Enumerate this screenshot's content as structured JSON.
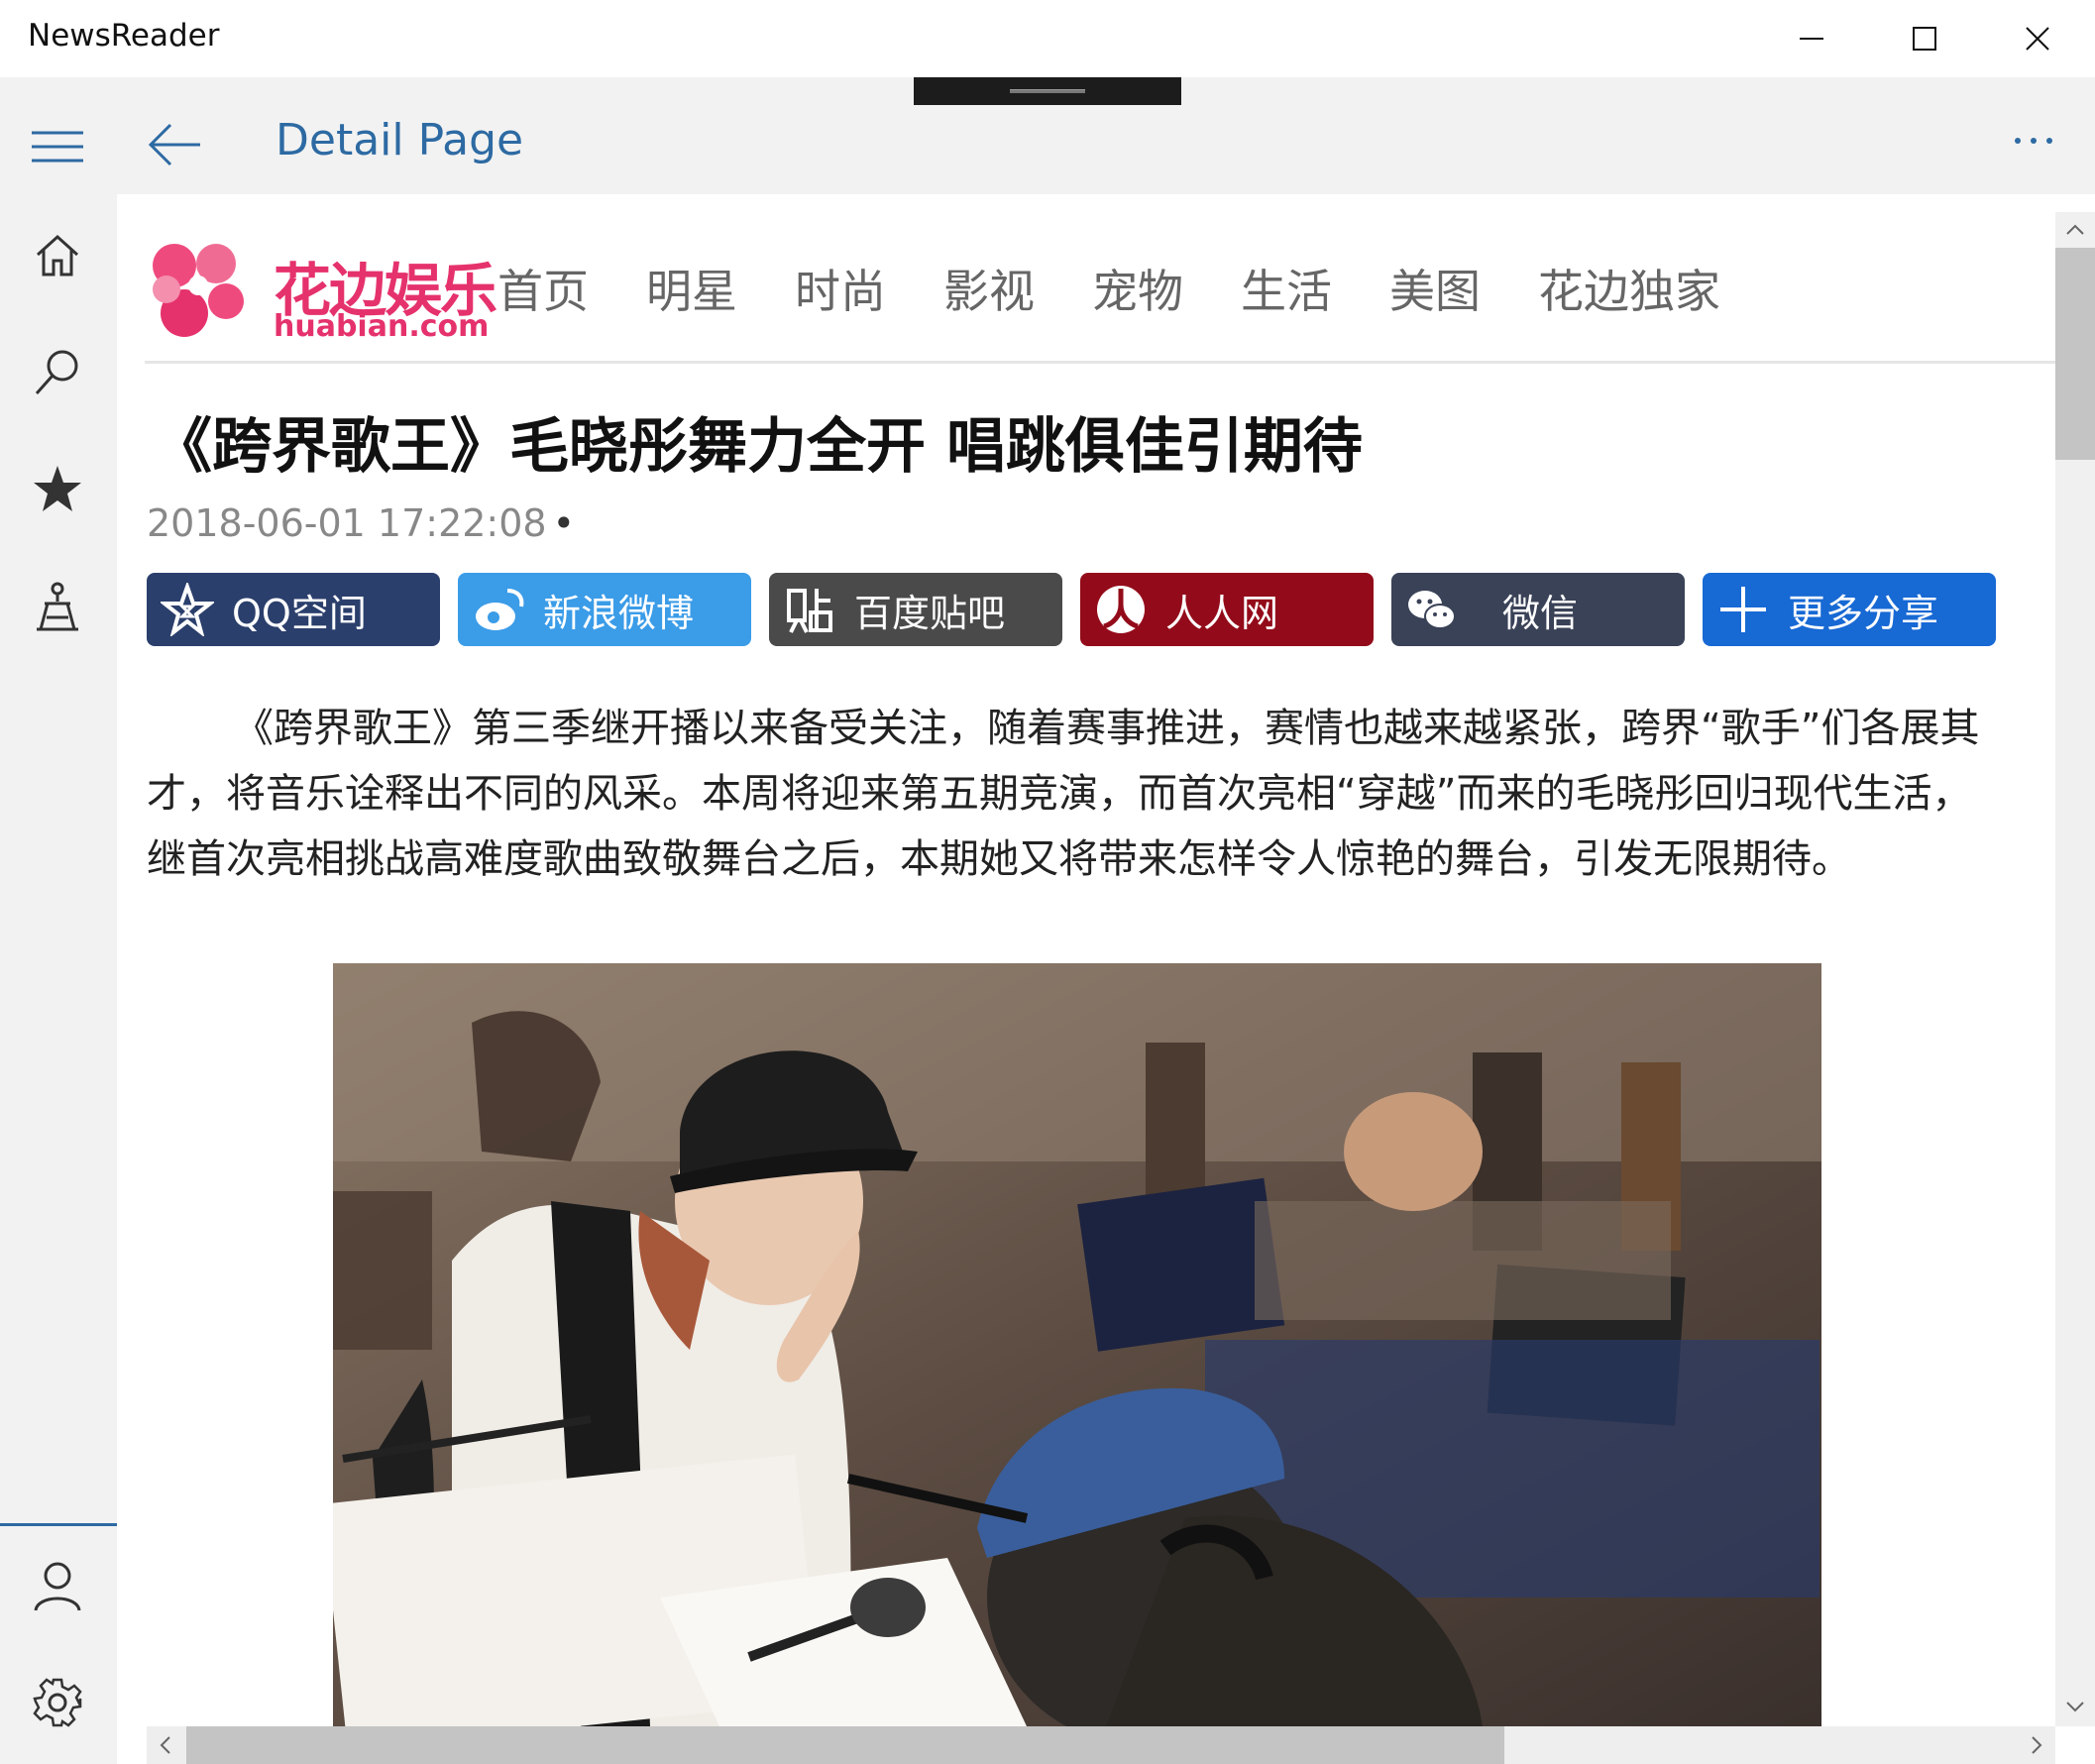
{
  "window": {
    "app_title": "NewsReader",
    "controls": [
      "minimize-icon",
      "maximize-icon",
      "close-icon"
    ]
  },
  "header": {
    "title": "Detail Page",
    "left_icons": [
      "hamburger-menu-icon",
      "back-arrow-icon"
    ],
    "right_icon": "more-ellipsis-icon"
  },
  "rail": {
    "top_items": [
      "home-icon",
      "search-icon",
      "favorites-star-icon",
      "explore-icon"
    ],
    "bottom_items": [
      "account-icon",
      "settings-gear-icon"
    ]
  },
  "site": {
    "logo_cn": "花边娱乐",
    "logo_en": "huabian.com",
    "nav": [
      "首页",
      "明星",
      "时尚",
      "影视",
      "宠物",
      "生活",
      "美图",
      "花边独家"
    ]
  },
  "article": {
    "title": "《跨界歌王》毛晓彤舞力全开 唱跳俱佳引期待",
    "time": "2018-06-01 17:22:08",
    "time_suffix": "•",
    "paragraph": "《跨界歌王》第三季继开播以来备受关注，随着赛事推进，赛情也越来越紧张，跨界“歌手”们各展其才，将音乐诠释出不同的风采。本周将迎来第五期竞演，而首次亮相“穿越”而来的毛晓彤回归现代生活，继首次亮相挑战高难度歌曲致敬舞台之后，本期她又将带来怎样令人惊艳的舞台，引发无限期待。"
  },
  "share": [
    {
      "label": "QQ空间",
      "color": "#2b3f6c",
      "icon": "qzone-star-icon"
    },
    {
      "label": "新浪微博",
      "color": "#3b9ce8",
      "icon": "weibo-icon"
    },
    {
      "label": "百度贴吧",
      "color": "#4a4a4a",
      "icon": "tieba-icon"
    },
    {
      "label": "人人网",
      "color": "#930b1a",
      "icon": "renren-icon"
    },
    {
      "label": "微信",
      "color": "#3a4257",
      "icon": "wechat-icon"
    },
    {
      "label": "更多分享",
      "color": "#1769d4",
      "icon": "plus-icon"
    }
  ],
  "colors": {
    "accent": "#2d6aa3",
    "logo_pink": "#e5326c"
  }
}
